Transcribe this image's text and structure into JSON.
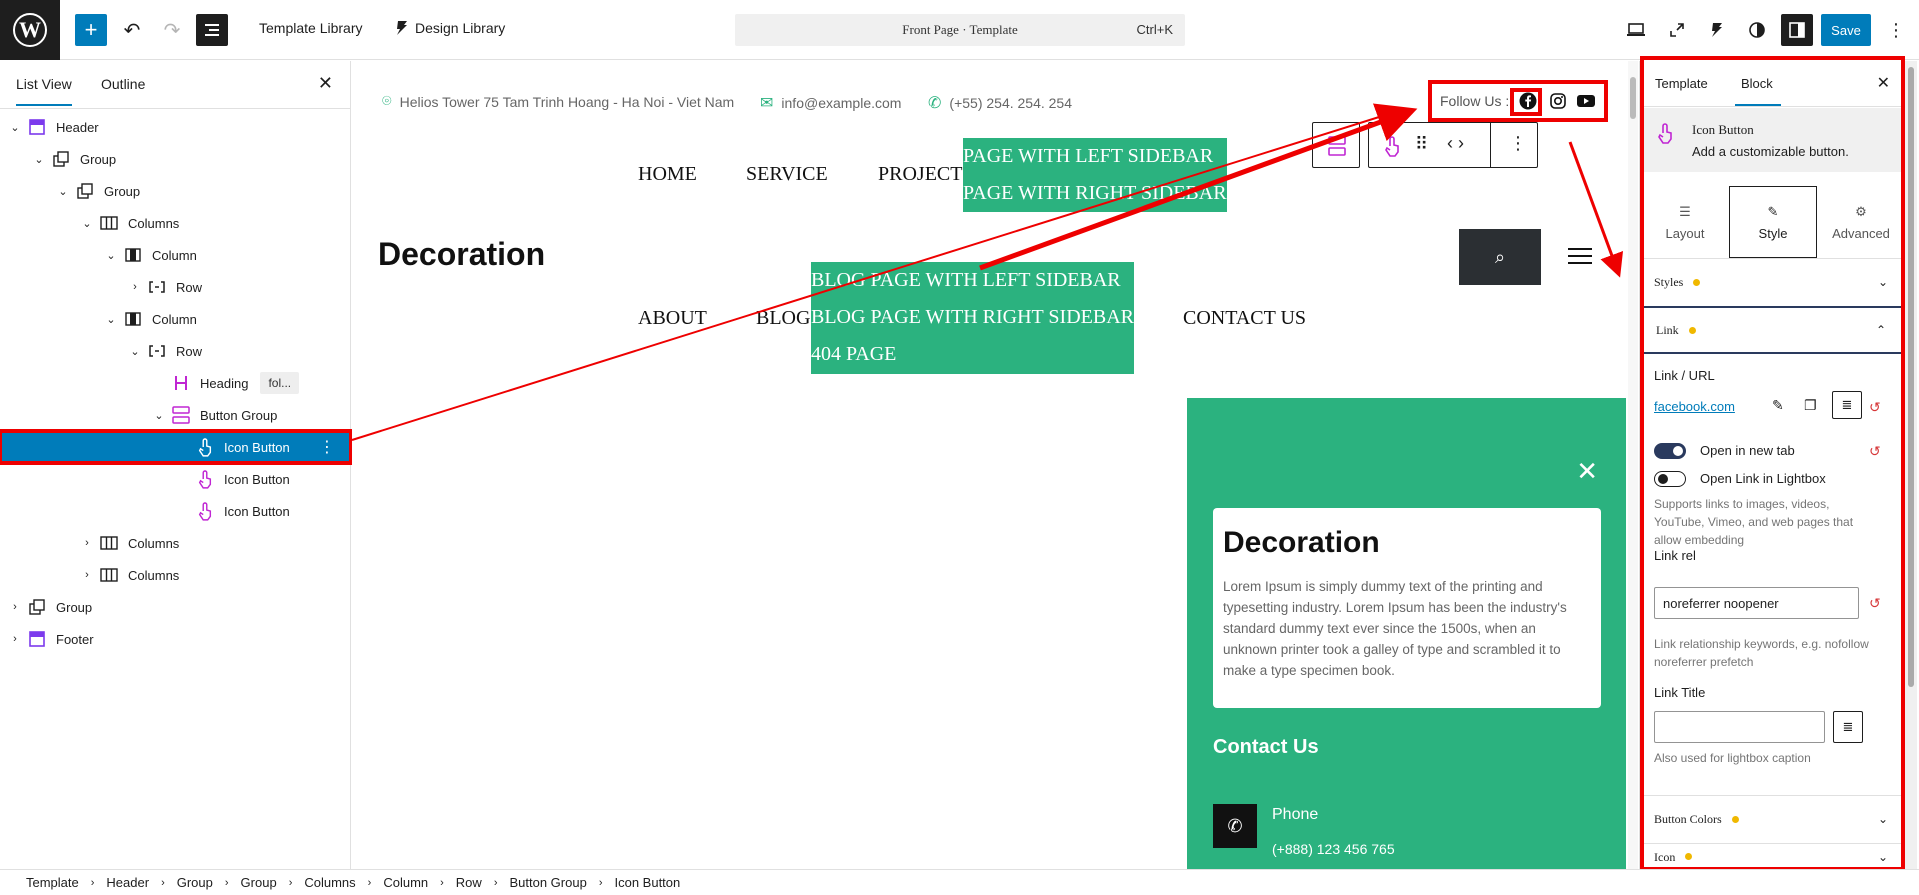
{
  "topbar": {
    "template_library": "Template Library",
    "design_library": "Design Library",
    "doc_title": "Front Page · Template",
    "shortcut": "Ctrl+K",
    "save": "Save"
  },
  "list_view": {
    "tab_list": "List View",
    "tab_outline": "Outline",
    "items": [
      {
        "label": "Header",
        "level": 0,
        "chev": "⌄",
        "icon": "template-part-icon"
      },
      {
        "label": "Group",
        "level": 1,
        "chev": "⌄",
        "icon": "group-icon"
      },
      {
        "label": "Group",
        "level": 2,
        "chev": "⌄",
        "icon": "group-icon"
      },
      {
        "label": "Columns",
        "level": 3,
        "chev": "⌄",
        "icon": "columns-icon"
      },
      {
        "label": "Column",
        "level": 4,
        "chev": "⌄",
        "icon": "column-icon"
      },
      {
        "label": "Row",
        "level": 5,
        "chev": "›",
        "icon": "row-icon"
      },
      {
        "label": "Column",
        "level": 4,
        "chev": "⌄",
        "icon": "column-icon"
      },
      {
        "label": "Row",
        "level": 5,
        "chev": "⌄",
        "icon": "row-icon"
      },
      {
        "label": "Heading",
        "level": 6,
        "chev": "",
        "icon": "heading-icon",
        "badge": "fol..."
      },
      {
        "label": "Button Group",
        "level": 6,
        "chev": "⌄",
        "icon": "button-group-icon"
      },
      {
        "label": "Icon Button",
        "level": 7,
        "chev": "",
        "icon": "icon-button-icon",
        "selected": true
      },
      {
        "label": "Icon Button",
        "level": 7,
        "chev": "",
        "icon": "icon-button-icon"
      },
      {
        "label": "Icon Button",
        "level": 7,
        "chev": "",
        "icon": "icon-button-icon"
      },
      {
        "label": "Columns",
        "level": 3,
        "chev": "›",
        "icon": "columns-icon"
      },
      {
        "label": "Columns",
        "level": 3,
        "chev": "›",
        "icon": "columns-icon"
      },
      {
        "label": "Group",
        "level": 0,
        "chev": "›",
        "icon": "group-icon"
      },
      {
        "label": "Footer",
        "level": 0,
        "chev": "›",
        "icon": "template-part-icon"
      }
    ]
  },
  "canvas": {
    "address": "Helios Tower 75 Tam Trinh Hoang - Ha Noi - Viet Nam",
    "email": "info@example.com",
    "phone": "(+55) 254. 254. 254",
    "follow_us": "Follow Us :",
    "nav": {
      "home": "HOME",
      "service": "SERVICE",
      "project": "PROJECT",
      "about": "ABOUT",
      "blog": "BLOG",
      "contact": "CONTACT US",
      "sub1": [
        "PAGE WITH LEFT SIDEBAR",
        "PAGE WITH RIGHT SIDEBAR"
      ],
      "sub2": [
        "BLOG PAGE WITH LEFT SIDEBAR",
        "BLOG PAGE WITH RIGHT SIDEBAR",
        "404 PAGE"
      ]
    },
    "site_title": "Decoration",
    "panel": {
      "close": "✕",
      "card_title": "Decoration",
      "card_text": "Lorem Ipsum is simply dummy text of the printing and typesetting industry. Lorem Ipsum has been the industry's standard dummy text ever since the 1500s, when an unknown printer took a galley of type and scrambled it to make a type specimen book.",
      "contact_title": "Contact Us",
      "phone_label": "Phone",
      "phone_value": "(+888) 123 456 765"
    }
  },
  "sidebar": {
    "tab_template": "Template",
    "tab_block": "Block",
    "block_name": "Icon Button",
    "block_desc": "Add a customizable button.",
    "seg_layout": "Layout",
    "seg_style": "Style",
    "seg_advanced": "Advanced",
    "styles": "Styles",
    "link": "Link",
    "link_url_label": "Link / URL",
    "link_url": "facebook.com",
    "open_new_tab": "Open in new tab",
    "open_lightbox": "Open Link in Lightbox",
    "lightbox_help": "Supports links to images, videos, YouTube, Vimeo, and web pages that allow embedding",
    "link_rel_label": "Link rel",
    "link_rel_value": "noreferrer noopener",
    "link_rel_help": "Link relationship keywords, e.g. nofollow noreferrer prefetch",
    "link_title_label": "Link Title",
    "link_title_value": "",
    "link_title_help": "Also used for lightbox caption",
    "button_colors": "Button Colors",
    "icon": "Icon"
  },
  "breadcrumb": [
    "Template",
    "Header",
    "Group",
    "Group",
    "Columns",
    "Column",
    "Row",
    "Button Group",
    "Icon Button"
  ],
  "colors": {
    "accent": "#007cba",
    "green": "#2bb27f",
    "annotation": "#e00000",
    "pink_icon": "#c026d3"
  }
}
